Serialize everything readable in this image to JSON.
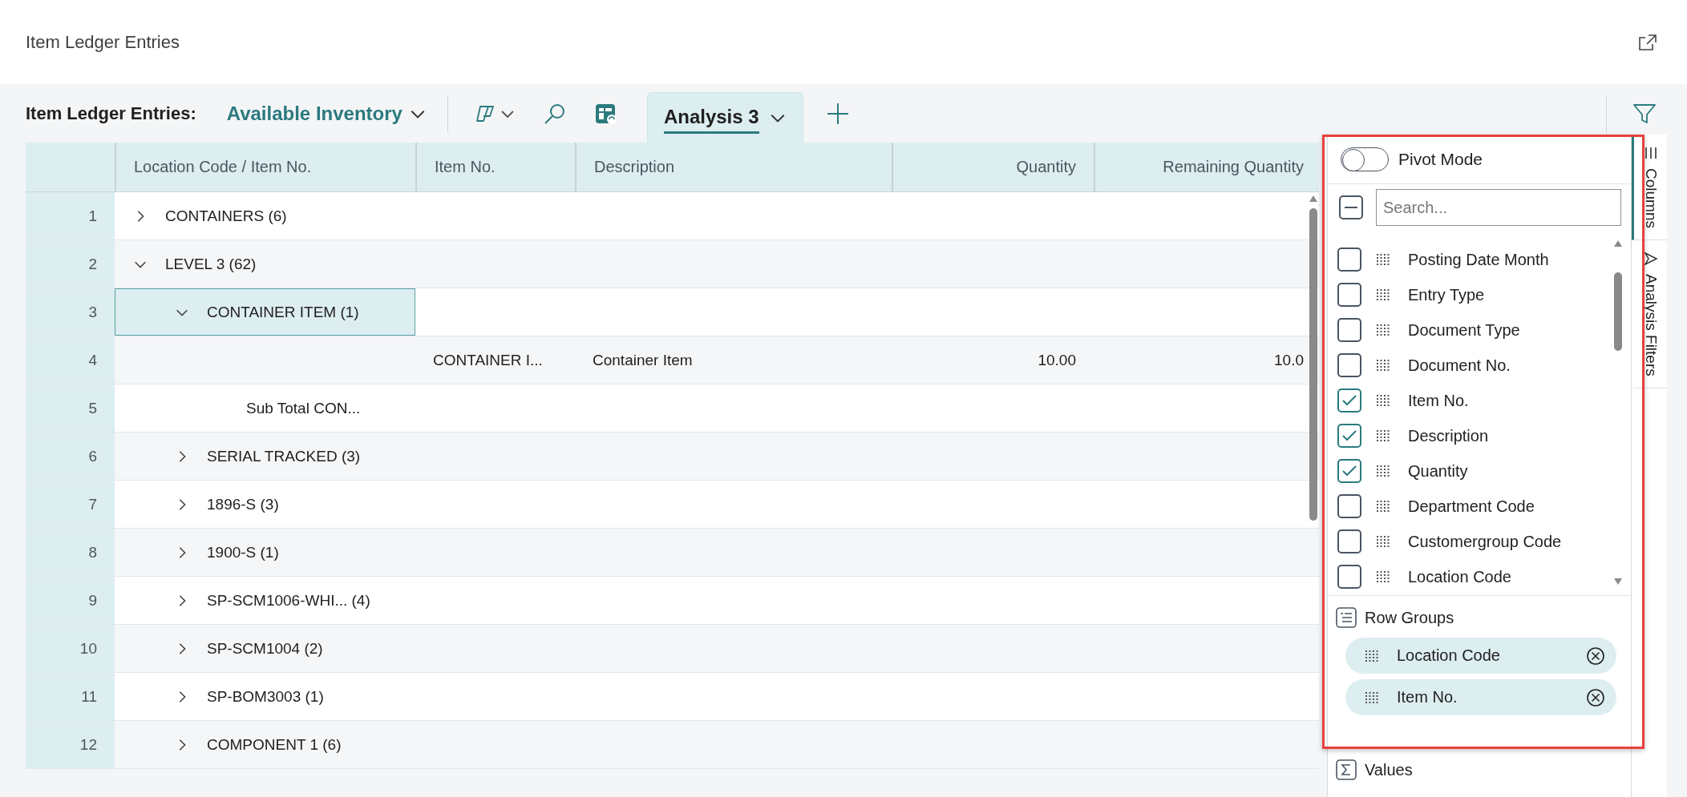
{
  "page": {
    "title": "Item Ledger Entries"
  },
  "toolbar": {
    "caption": "Item Ledger Entries:",
    "view": "Available Inventory",
    "tabs": [
      {
        "label": "Analysis 3",
        "selected": true
      }
    ]
  },
  "table": {
    "columns": [
      "Location Code / Item No.",
      "Item No.",
      "Description",
      "Quantity",
      "Remaining Quantity"
    ],
    "rows": [
      {
        "number": "1",
        "kind": "group",
        "label": "CONTAINERS (6)",
        "expanded": false,
        "selected": false
      },
      {
        "number": "2",
        "kind": "group",
        "label": "LEVEL 3 (62)",
        "expanded": true,
        "selected": false,
        "children": [
          {
            "number": "3",
            "kind": "group",
            "label": "CONTAINER ITEM (1)",
            "expanded": true,
            "selected": true,
            "children": [
              {
                "number": "4",
                "kind": "detail",
                "item_no": "CONTAINER I...",
                "description": "Container Item",
                "quantity": "10.00",
                "remaining_quantity": "10.0"
              },
              {
                "number": "5",
                "kind": "subtotal",
                "label": "Sub Total CON..."
              }
            ]
          },
          {
            "number": "6",
            "kind": "group",
            "label": "SERIAL TRACKED (3)",
            "expanded": false,
            "selected": false
          },
          {
            "number": "7",
            "kind": "group",
            "label": "1896-S (3)",
            "expanded": false,
            "selected": false
          },
          {
            "number": "8",
            "kind": "group",
            "label": "1900-S (1)",
            "expanded": false,
            "selected": false
          },
          {
            "number": "9",
            "kind": "group",
            "label": "SP-SCM1006-WHI... (4)",
            "expanded": false,
            "selected": false
          },
          {
            "number": "10",
            "kind": "group",
            "label": "SP-SCM1004 (2)",
            "expanded": false,
            "selected": false
          },
          {
            "number": "11",
            "kind": "group",
            "label": "SP-BOM3003 (1)",
            "expanded": false,
            "selected": false
          },
          {
            "number": "12",
            "kind": "group",
            "label": "COMPONENT 1 (6)",
            "expanded": false,
            "selected": false
          }
        ]
      }
    ]
  },
  "panel": {
    "pivot_mode": {
      "label": "Pivot Mode",
      "on": false
    },
    "select_all": {
      "indeterminate": true
    },
    "search": {
      "placeholder": "Search..."
    },
    "columns": [
      {
        "label": "Posting Date Month",
        "checked": false
      },
      {
        "label": "Entry Type",
        "checked": false
      },
      {
        "label": "Document Type",
        "checked": false
      },
      {
        "label": "Document No.",
        "checked": false
      },
      {
        "label": "Item No.",
        "checked": true
      },
      {
        "label": "Description",
        "checked": true
      },
      {
        "label": "Quantity",
        "checked": true
      },
      {
        "label": "Department Code",
        "checked": false
      },
      {
        "label": "Customergroup Code",
        "checked": false
      },
      {
        "label": "Location Code",
        "checked": false
      }
    ],
    "row_groups": {
      "title": "Row Groups",
      "items": [
        "Location Code",
        "Item No."
      ]
    },
    "values": {
      "title": "Values"
    }
  },
  "side_tabs": [
    {
      "label": "Columns",
      "selected": true
    },
    {
      "label": "Analysis Filters",
      "selected": false
    }
  ]
}
